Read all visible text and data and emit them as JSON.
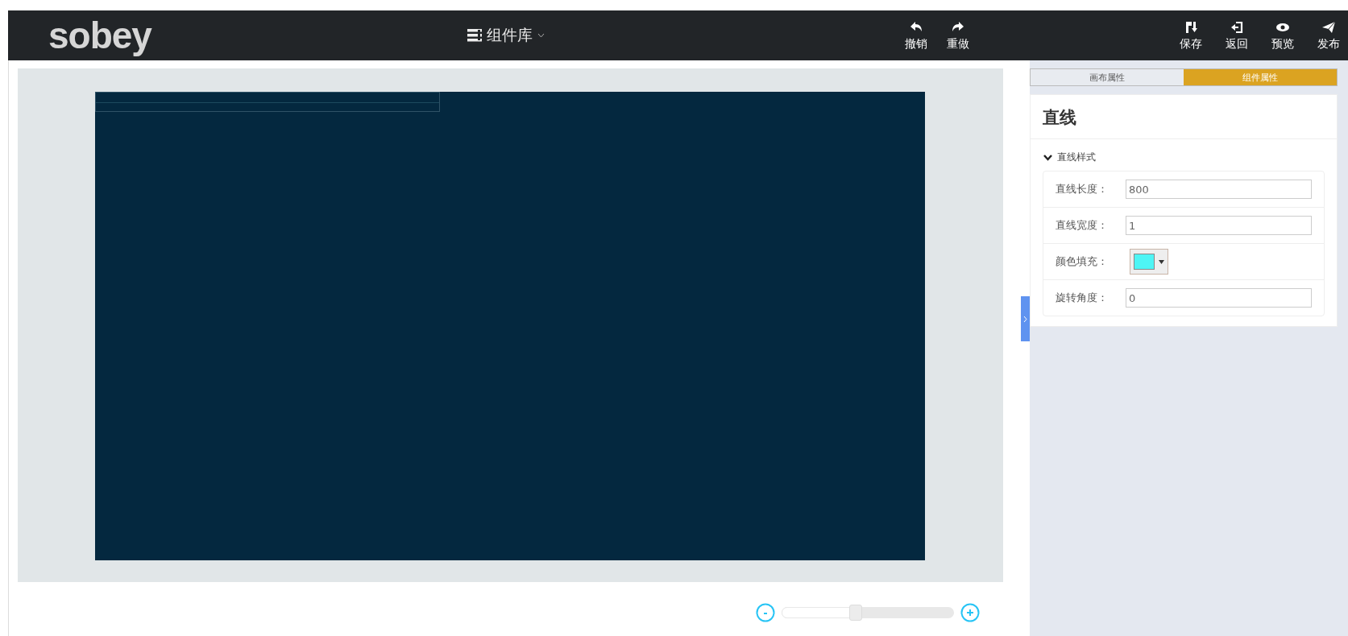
{
  "header": {
    "logo": "sobey",
    "library": "组件库",
    "edit_actions": [
      {
        "kind": "undo",
        "label": "撤销"
      },
      {
        "kind": "redo",
        "label": "重做"
      }
    ],
    "file_actions": [
      {
        "kind": "save",
        "label": "保存"
      },
      {
        "kind": "back",
        "label": "返回"
      },
      {
        "kind": "preview",
        "label": "预览"
      },
      {
        "kind": "publish",
        "label": "发布"
      }
    ]
  },
  "canvas": {
    "selected_line": true
  },
  "zoom": {
    "level": 0.43
  },
  "panel": {
    "tabs": [
      {
        "label": "画布属性",
        "selected": false
      },
      {
        "label": "组件属性",
        "selected": true
      }
    ],
    "title": "直线",
    "section": {
      "label": "直线样式",
      "expanded": true
    },
    "fields": [
      {
        "kind": "text",
        "label": "直线长度：",
        "value": "800"
      },
      {
        "kind": "text",
        "label": "直线宽度：",
        "value": "1"
      },
      {
        "kind": "color",
        "label": "颜色填充：",
        "color": "#4ef5f5"
      },
      {
        "kind": "text",
        "label": "旋转角度：",
        "value": "0"
      }
    ]
  }
}
